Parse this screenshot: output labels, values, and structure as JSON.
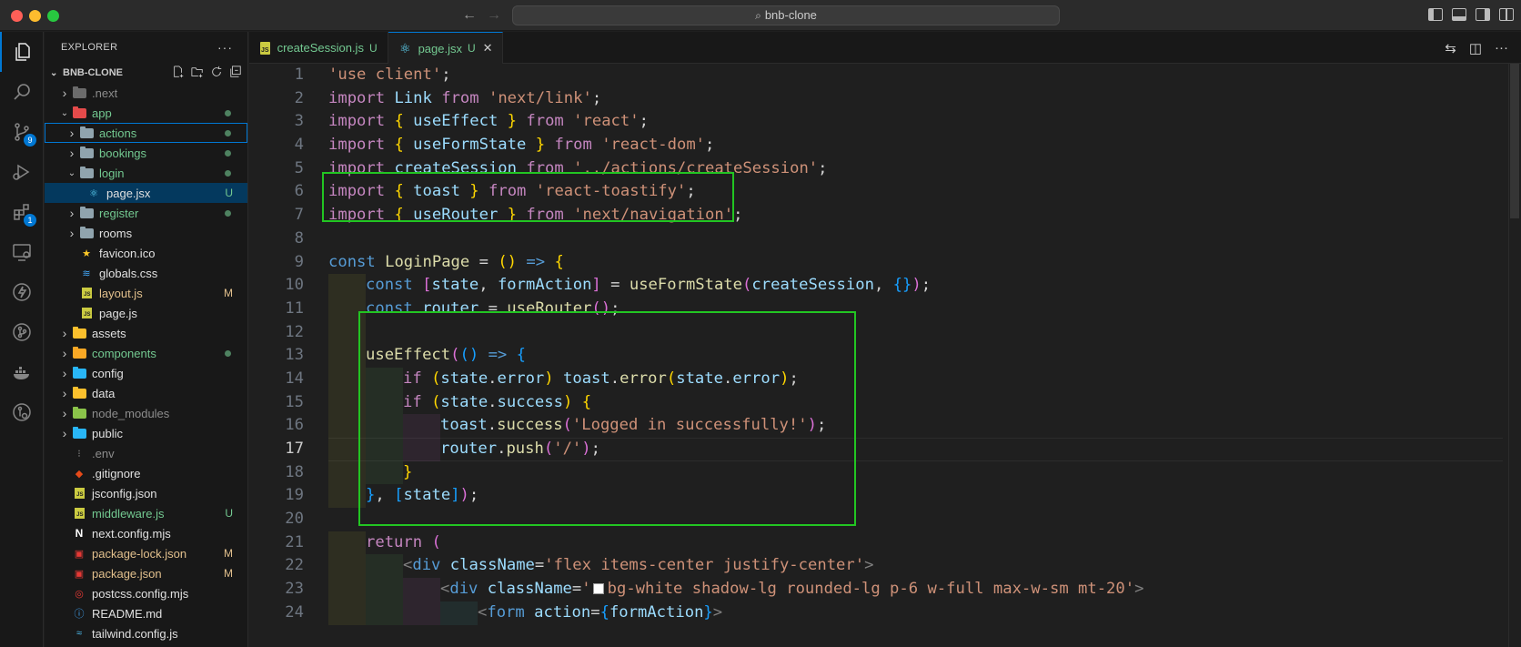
{
  "window": {
    "search_text": "bnb-clone"
  },
  "activity_bar": {
    "source_control_badge": "9",
    "extensions_badge": "1"
  },
  "sidebar": {
    "title": "EXPLORER",
    "more": "···",
    "project": "BNB-CLONE",
    "tree": [
      {
        "label": ".next",
        "depth": 0,
        "kind": "folder",
        "collapsed": true,
        "color": "dim",
        "icon": "next-folder-icon"
      },
      {
        "label": "app",
        "depth": 0,
        "kind": "folder",
        "collapsed": false,
        "color": "git",
        "dot": true,
        "icon": "app-folder-icon"
      },
      {
        "label": "actions",
        "depth": 1,
        "kind": "folder",
        "collapsed": true,
        "color": "git",
        "dot": true,
        "focused": true,
        "icon": "folder-icon"
      },
      {
        "label": "bookings",
        "depth": 1,
        "kind": "folder",
        "collapsed": true,
        "color": "git",
        "dot": true,
        "icon": "folder-icon"
      },
      {
        "label": "login",
        "depth": 1,
        "kind": "folder",
        "collapsed": false,
        "color": "git",
        "dot": true,
        "icon": "folder-open-icon"
      },
      {
        "label": "page.jsx",
        "depth": 2,
        "kind": "file",
        "color": "white",
        "status": "U",
        "selected": true,
        "icon": "react-icon"
      },
      {
        "label": "register",
        "depth": 1,
        "kind": "folder",
        "collapsed": true,
        "color": "git",
        "dot": true,
        "icon": "folder-icon"
      },
      {
        "label": "rooms",
        "depth": 1,
        "kind": "folder",
        "collapsed": true,
        "color": "white",
        "icon": "folder-icon"
      },
      {
        "label": "favicon.ico",
        "depth": 1,
        "kind": "file",
        "color": "white",
        "icon": "star-icon"
      },
      {
        "label": "globals.css",
        "depth": 1,
        "kind": "file",
        "color": "white",
        "icon": "css-icon"
      },
      {
        "label": "layout.js",
        "depth": 1,
        "kind": "file",
        "color": "mod",
        "status": "M",
        "icon": "js-icon"
      },
      {
        "label": "page.js",
        "depth": 1,
        "kind": "file",
        "color": "white",
        "icon": "js-icon"
      },
      {
        "label": "assets",
        "depth": 0,
        "kind": "folder",
        "collapsed": true,
        "color": "white",
        "icon": "assets-folder-icon"
      },
      {
        "label": "components",
        "depth": 0,
        "kind": "folder",
        "collapsed": true,
        "color": "git",
        "dot": true,
        "icon": "components-folder-icon"
      },
      {
        "label": "config",
        "depth": 0,
        "kind": "folder",
        "collapsed": true,
        "color": "white",
        "icon": "config-folder-icon"
      },
      {
        "label": "data",
        "depth": 0,
        "kind": "folder",
        "collapsed": true,
        "color": "white",
        "icon": "data-folder-icon"
      },
      {
        "label": "node_modules",
        "depth": 0,
        "kind": "folder",
        "collapsed": true,
        "color": "dim",
        "icon": "node-folder-icon"
      },
      {
        "label": "public",
        "depth": 0,
        "kind": "folder",
        "collapsed": true,
        "color": "white",
        "icon": "public-folder-icon"
      },
      {
        "label": ".env",
        "depth": 0,
        "kind": "file",
        "color": "dim",
        "icon": "env-icon"
      },
      {
        "label": ".gitignore",
        "depth": 0,
        "kind": "file",
        "color": "white",
        "icon": "git-icon"
      },
      {
        "label": "jsconfig.json",
        "depth": 0,
        "kind": "file",
        "color": "white",
        "icon": "js-icon"
      },
      {
        "label": "middleware.js",
        "depth": 0,
        "kind": "file",
        "color": "git",
        "status": "U",
        "icon": "js-icon"
      },
      {
        "label": "next.config.mjs",
        "depth": 0,
        "kind": "file",
        "color": "white",
        "icon": "next-icon"
      },
      {
        "label": "package-lock.json",
        "depth": 0,
        "kind": "file",
        "color": "mod",
        "status": "M",
        "icon": "npm-icon"
      },
      {
        "label": "package.json",
        "depth": 0,
        "kind": "file",
        "color": "mod",
        "status": "M",
        "icon": "npm-icon"
      },
      {
        "label": "postcss.config.mjs",
        "depth": 0,
        "kind": "file",
        "color": "white",
        "icon": "postcss-icon"
      },
      {
        "label": "README.md",
        "depth": 0,
        "kind": "file",
        "color": "white",
        "icon": "info-icon"
      },
      {
        "label": "tailwind.config.js",
        "depth": 0,
        "kind": "file",
        "color": "white",
        "icon": "tailwind-icon"
      }
    ]
  },
  "tabs": [
    {
      "label": "createSession.js",
      "status": "U",
      "active": false,
      "icon": "js-icon"
    },
    {
      "label": "page.jsx",
      "status": "U",
      "active": true,
      "icon": "react-icon",
      "close": "✕"
    }
  ],
  "editor": {
    "current_line": 17,
    "lines": [
      {
        "n": "1",
        "indent": 0,
        "html": "<span class='s'>'use client'</span><span class='p'>;</span>"
      },
      {
        "n": "2",
        "indent": 0,
        "html": "<span class='k'>import</span> <span class='v'>Link</span> <span class='k'>from</span> <span class='s'>'next/link'</span><span class='p'>;</span>"
      },
      {
        "n": "3",
        "indent": 0,
        "html": "<span class='k'>import</span> <span class='b1'>{</span> <span class='v'>useEffect</span> <span class='b1'>}</span> <span class='k'>from</span> <span class='s'>'react'</span><span class='p'>;</span>"
      },
      {
        "n": "4",
        "indent": 0,
        "html": "<span class='k'>import</span> <span class='b1'>{</span> <span class='v'>useFormState</span> <span class='b1'>}</span> <span class='k'>from</span> <span class='s'>'react-dom'</span><span class='p'>;</span>"
      },
      {
        "n": "5",
        "indent": 0,
        "html": "<span class='k'>import</span> <span class='v'>createSession</span> <span class='k'>from</span> <span class='s'>'../actions/createSession'</span><span class='p'>;</span>"
      },
      {
        "n": "6",
        "indent": 0,
        "html": "<span class='k'>import</span> <span class='b1'>{</span> <span class='v'>toast</span> <span class='b1'>}</span> <span class='k'>from</span> <span class='s'>'react-toastify'</span><span class='p'>;</span>"
      },
      {
        "n": "7",
        "indent": 0,
        "html": "<span class='k'>import</span> <span class='b1'>{</span> <span class='v'>useRouter</span> <span class='b1'>}</span> <span class='k'>from</span> <span class='s'>'next/navigation'</span><span class='p'>;</span>"
      },
      {
        "n": "8",
        "indent": 0,
        "html": ""
      },
      {
        "n": "9",
        "indent": 0,
        "html": "<span class='kb'>const</span> <span class='f'>LoginPage</span> <span class='p'>=</span> <span class='b1'>()</span> <span class='kb'>=&gt;</span> <span class='b1'>{</span>"
      },
      {
        "n": "10",
        "indent": 1,
        "html": "<span class='kb'>const</span> <span class='b2'>[</span><span class='v'>state</span><span class='p'>,</span> <span class='v'>formAction</span><span class='b2'>]</span> <span class='p'>=</span> <span class='f'>useFormState</span><span class='b2'>(</span><span class='v'>createSession</span><span class='p'>,</span> <span class='b3'>{}</span><span class='b2'>)</span><span class='p'>;</span>"
      },
      {
        "n": "11",
        "indent": 1,
        "html": "<span class='kb'>const</span> <span class='v'>router</span> <span class='p'>=</span> <span class='f'>useRouter</span><span class='b2'>()</span><span class='p'>;</span>"
      },
      {
        "n": "12",
        "indent": 1,
        "html": ""
      },
      {
        "n": "13",
        "indent": 1,
        "html": "<span class='f'>useEffect</span><span class='b2'>(</span><span class='b3'>()</span> <span class='kb'>=&gt;</span> <span class='b3'>{</span>"
      },
      {
        "n": "14",
        "indent": 2,
        "html": "<span class='k'>if</span> <span class='b1'>(</span><span class='v'>state</span><span class='p'>.</span><span class='v'>error</span><span class='b1'>)</span> <span class='v'>toast</span><span class='p'>.</span><span class='f'>error</span><span class='b1'>(</span><span class='v'>state</span><span class='p'>.</span><span class='v'>error</span><span class='b1'>)</span><span class='p'>;</span>"
      },
      {
        "n": "15",
        "indent": 2,
        "html": "<span class='k'>if</span> <span class='b1'>(</span><span class='v'>state</span><span class='p'>.</span><span class='v'>success</span><span class='b1'>)</span> <span class='b1'>{</span>"
      },
      {
        "n": "16",
        "indent": 3,
        "html": "<span class='v'>toast</span><span class='p'>.</span><span class='f'>success</span><span class='b2'>(</span><span class='s'>'Logged in successfully!'</span><span class='b2'>)</span><span class='p'>;</span>"
      },
      {
        "n": "17",
        "indent": 3,
        "html": "<span class='v'>router</span><span class='p'>.</span><span class='f'>push</span><span class='b2'>(</span><span class='s'>'/'</span><span class='b2'>)</span><span class='p'>;</span>"
      },
      {
        "n": "18",
        "indent": 2,
        "html": "<span class='b1'>}</span>"
      },
      {
        "n": "19",
        "indent": 1,
        "html": "<span class='b3'>}</span><span class='p'>,</span> <span class='b3'>[</span><span class='v'>state</span><span class='b3'>]</span><span class='b2'>)</span><span class='p'>;</span>"
      },
      {
        "n": "20",
        "indent": 0,
        "html": ""
      },
      {
        "n": "21",
        "indent": 1,
        "html": "<span class='k'>return</span> <span class='b2'>(</span>"
      },
      {
        "n": "22",
        "indent": 2,
        "html": "<span class='tag'>&lt;</span><span class='tagn'>div</span> <span class='attr'>className</span><span class='p'>=</span><span class='s'>'flex items-center justify-center'</span><span class='tag'>&gt;</span>"
      },
      {
        "n": "23",
        "indent": 3,
        "html": "<span class='tag'>&lt;</span><span class='tagn'>div</span> <span class='attr'>className</span><span class='p'>=</span><span class='s'>'<span class=\"swatch\"></span>bg-white shadow-lg rounded-lg p-6 w-full max-w-sm mt-20'</span><span class='tag'>&gt;</span>"
      },
      {
        "n": "24",
        "indent": 4,
        "html": "<span class='tag'>&lt;</span><span class='tagn'>form</span> <span class='attr'>action</span><span class='p'>=</span><span class='b3'>{</span><span class='v'>formAction</span><span class='b3'>}</span><span class='tag'>&gt;</span>"
      }
    ]
  }
}
